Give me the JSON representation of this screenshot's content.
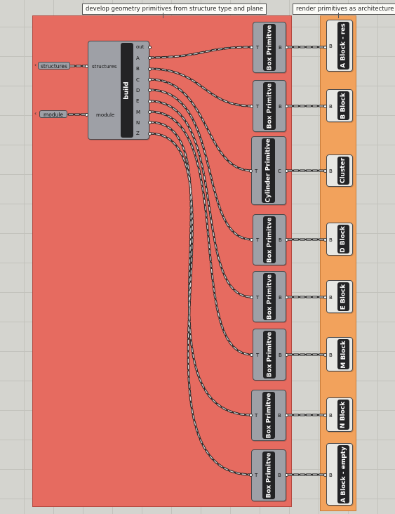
{
  "groups": {
    "geometry": {
      "title": "develop geometry primitives from structure type and plane"
    },
    "render": {
      "title": "render primitives as architecture"
    }
  },
  "params": {
    "structures": "structures",
    "module": "module"
  },
  "build": {
    "name": "build",
    "inputs": [
      "structures",
      "module"
    ],
    "outputs": [
      "out",
      "A",
      "B",
      "C",
      "D",
      "E",
      "M",
      "N",
      "Z"
    ]
  },
  "primitives": [
    {
      "label": "Box Primitve",
      "in": "T",
      "out": "B"
    },
    {
      "label": "Box Primitve",
      "in": "T",
      "out": "B"
    },
    {
      "label": "Cylinder Primitive",
      "in": "T",
      "out": "C"
    },
    {
      "label": "Box Primitve",
      "in": "T",
      "out": "B"
    },
    {
      "label": "Box Primitve",
      "in": "T",
      "out": "B"
    },
    {
      "label": "Box Primitve",
      "in": "T",
      "out": "B"
    },
    {
      "label": "Box Primitve",
      "in": "T",
      "out": "B"
    },
    {
      "label": "Box Primitve",
      "in": "T",
      "out": "B"
    }
  ],
  "blocks": [
    {
      "label": "A Block - res",
      "in": "B"
    },
    {
      "label": "B Block",
      "in": "B"
    },
    {
      "label": "Cluster",
      "in": "B"
    },
    {
      "label": "D Block",
      "in": "B"
    },
    {
      "label": "E Block",
      "in": "B"
    },
    {
      "label": "M Block",
      "in": "B"
    },
    {
      "label": "N Block",
      "in": "B"
    },
    {
      "label": "A Block - empty",
      "in": "B"
    }
  ]
}
